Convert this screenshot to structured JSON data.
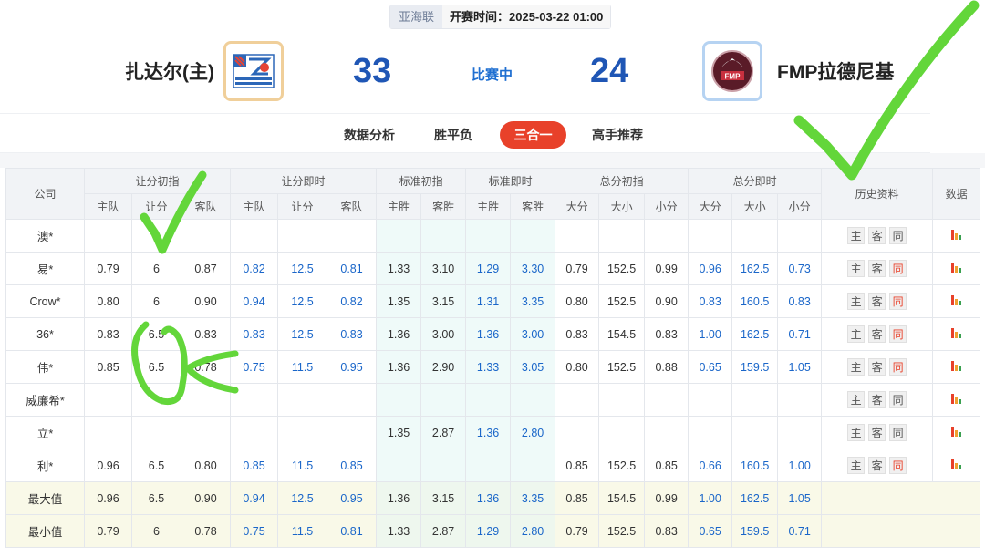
{
  "match": {
    "league": "亚海联",
    "kickoff": "开赛时间：2025-03-22 01:00",
    "home_name": "扎达尔(主)",
    "away_name": "FMP拉德尼基",
    "home_score": "33",
    "away_score": "24",
    "status": "比赛中",
    "away_logo_text": "FMP"
  },
  "tabs": [
    {
      "label": "数据分析",
      "active": false
    },
    {
      "label": "胜平负",
      "active": false
    },
    {
      "label": "三合一",
      "active": true
    },
    {
      "label": "高手推荐",
      "active": false
    }
  ],
  "table": {
    "company_header": "公司",
    "groups": [
      "让分初指",
      "让分即时",
      "标准初指",
      "标准即时",
      "总分初指",
      "总分即时"
    ],
    "history_header": "历史资料",
    "data_header": "数据",
    "sub_headers": [
      "主队",
      "让分",
      "客队",
      "主队",
      "让分",
      "客队",
      "主胜",
      "客胜",
      "主胜",
      "客胜",
      "大分",
      "大小",
      "小分",
      "大分",
      "大小",
      "小分"
    ],
    "rows": [
      {
        "company": "澳*",
        "cells": [
          "",
          "",
          "",
          "",
          "",
          "",
          "",
          "",
          "",
          "",
          "",
          "",
          "",
          "",
          "",
          ""
        ],
        "hist": [
          "主",
          "客",
          "同"
        ],
        "hist_red": false
      },
      {
        "company": "易*",
        "cells": [
          "0.79",
          "6",
          "0.87",
          "0.82",
          "12.5",
          "0.81",
          "1.33",
          "3.10",
          "1.29",
          "3.30",
          "0.79",
          "152.5",
          "0.99",
          "0.96",
          "162.5",
          "0.73"
        ],
        "hist": [
          "主",
          "客",
          "同"
        ],
        "hist_red": true
      },
      {
        "company": "Crow*",
        "cells": [
          "0.80",
          "6",
          "0.90",
          "0.94",
          "12.5",
          "0.82",
          "1.35",
          "3.15",
          "1.31",
          "3.35",
          "0.80",
          "152.5",
          "0.90",
          "0.83",
          "160.5",
          "0.83"
        ],
        "hist": [
          "主",
          "客",
          "同"
        ],
        "hist_red": true
      },
      {
        "company": "36*",
        "cells": [
          "0.83",
          "6.5",
          "0.83",
          "0.83",
          "12.5",
          "0.83",
          "1.36",
          "3.00",
          "1.36",
          "3.00",
          "0.83",
          "154.5",
          "0.83",
          "1.00",
          "162.5",
          "0.71"
        ],
        "hist": [
          "主",
          "客",
          "同"
        ],
        "hist_red": true
      },
      {
        "company": "伟*",
        "cells": [
          "0.85",
          "6.5",
          "0.78",
          "0.75",
          "11.5",
          "0.95",
          "1.36",
          "2.90",
          "1.33",
          "3.05",
          "0.80",
          "152.5",
          "0.88",
          "0.65",
          "159.5",
          "1.05"
        ],
        "hist": [
          "主",
          "客",
          "同"
        ],
        "hist_red": true
      },
      {
        "company": "威廉希*",
        "cells": [
          "",
          "",
          "",
          "",
          "",
          "",
          "",
          "",
          "",
          "",
          "",
          "",
          "",
          "",
          "",
          ""
        ],
        "hist": [
          "主",
          "客",
          "同"
        ],
        "hist_red": false
      },
      {
        "company": "立*",
        "cells": [
          "",
          "",
          "",
          "",
          "",
          "",
          "1.35",
          "2.87",
          "1.36",
          "2.80",
          "",
          "",
          "",
          "",
          "",
          ""
        ],
        "hist": [
          "主",
          "客",
          "同"
        ],
        "hist_red": false
      },
      {
        "company": "利*",
        "cells": [
          "0.96",
          "6.5",
          "0.80",
          "0.85",
          "11.5",
          "0.85",
          "",
          "",
          "",
          "",
          "0.85",
          "152.5",
          "0.85",
          "0.66",
          "160.5",
          "1.00"
        ],
        "hist": [
          "主",
          "客",
          "同"
        ],
        "hist_red": true
      }
    ],
    "summary": [
      {
        "label": "最大值",
        "cells": [
          "0.96",
          "6.5",
          "0.90",
          "0.94",
          "12.5",
          "0.95",
          "1.36",
          "3.15",
          "1.36",
          "3.35",
          "0.85",
          "154.5",
          "0.99",
          "1.00",
          "162.5",
          "1.05"
        ]
      },
      {
        "label": "最小值",
        "cells": [
          "0.79",
          "6",
          "0.78",
          "0.75",
          "11.5",
          "0.81",
          "1.33",
          "2.87",
          "1.29",
          "2.80",
          "0.79",
          "152.5",
          "0.83",
          "0.65",
          "159.5",
          "0.71"
        ]
      }
    ]
  },
  "colors": {
    "accent_red": "#e8412a",
    "score_blue": "#1f56b5",
    "live_odds_blue": "#1a66c9",
    "annotation_green": "#63d63a"
  },
  "icons": {
    "data_column": "bar-chart-icon",
    "home_logo": "zadar-club-logo",
    "away_logo": "fmp-club-logo"
  }
}
